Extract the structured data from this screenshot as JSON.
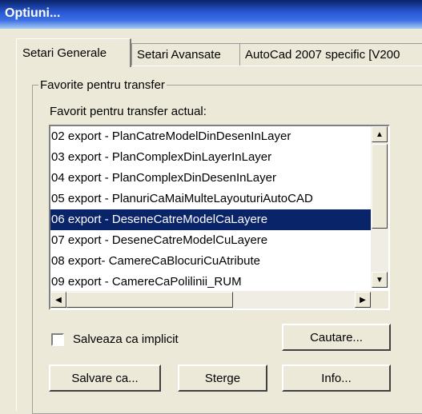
{
  "window": {
    "title": "Optiuni..."
  },
  "tabs": [
    {
      "label": "Setari Generale",
      "active": true
    },
    {
      "label": "Setari Avansate",
      "active": false
    },
    {
      "label": "AutoCad 2007 specific [V200",
      "active": false
    }
  ],
  "group": {
    "legend": "Favorite pentru transfer",
    "list_label": "Favorit pentru transfer actual:",
    "items": [
      "02 export - PlanCatreModelDinDesenInLayer",
      "03 export - PlanComplexDinLayerInLayer",
      "04 export - PlanComplexDinDesenInLayer",
      "05 export - PlanuriCaMaiMulteLayouturiAutoCAD",
      "06 export - DeseneCatreModelCaLayere",
      "07 export - DeseneCatreModelCuLayere",
      "08 export- CamereCaBlocuriCuAtribute",
      "09 export - CamereCaPolilinii_RUM"
    ],
    "selected_index": 4,
    "checkbox_label": "Salveaza ca implicit",
    "checkbox_checked": false,
    "buttons": {
      "search": "Cautare...",
      "save_as": "Salvare ca...",
      "delete": "Sterge",
      "info": "Info..."
    }
  }
}
